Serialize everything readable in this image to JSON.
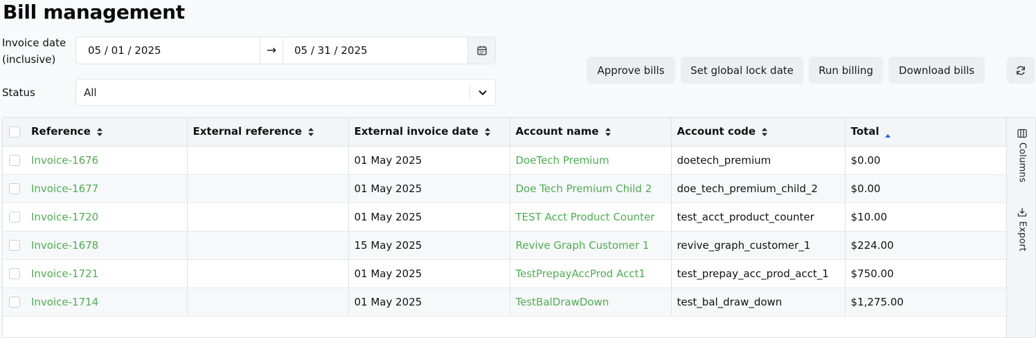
{
  "page": {
    "title": "Bill management"
  },
  "filters": {
    "invoice_date_label_line1": "Invoice date",
    "invoice_date_label_line2": "(inclusive)",
    "date_from": "05 / 01 / 2025",
    "date_arrow": "→",
    "date_to": "05 / 31 / 2025",
    "status_label": "Status",
    "status_value": "All"
  },
  "actions": {
    "approve": "Approve bills",
    "lock": "Set global lock date",
    "run": "Run billing",
    "download": "Download bills"
  },
  "table": {
    "columns": [
      "Reference",
      "External reference",
      "External invoice date",
      "Account name",
      "Account code",
      "Total"
    ],
    "sorted_column": "Total",
    "sort_direction": "ascending",
    "rows": [
      {
        "reference": "Invoice-1676",
        "external_reference": "",
        "external_invoice_date": "01 May 2025",
        "account_name": "DoeTech Premium",
        "account_code": "doetech_premium",
        "total": "$0.00"
      },
      {
        "reference": "Invoice-1677",
        "external_reference": "",
        "external_invoice_date": "01 May 2025",
        "account_name": "Doe Tech Premium Child 2",
        "account_code": "doe_tech_premium_child_2",
        "total": "$0.00"
      },
      {
        "reference": "Invoice-1720",
        "external_reference": "",
        "external_invoice_date": "01 May 2025",
        "account_name": "TEST Acct Product Counter",
        "account_code": "test_acct_product_counter",
        "total": "$10.00"
      },
      {
        "reference": "Invoice-1678",
        "external_reference": "",
        "external_invoice_date": "15 May 2025",
        "account_name": "Revive Graph Customer 1",
        "account_code": "revive_graph_customer_1",
        "total": "$224.00"
      },
      {
        "reference": "Invoice-1721",
        "external_reference": "",
        "external_invoice_date": "01 May 2025",
        "account_name": "TestPrepayAccProd Acct1",
        "account_code": "test_prepay_acc_prod_acct_1",
        "total": "$750.00"
      },
      {
        "reference": "Invoice-1714",
        "external_reference": "",
        "external_invoice_date": "01 May 2025",
        "account_name": "TestBalDrawDown",
        "account_code": "test_bal_draw_down",
        "total": "$1,275.00"
      }
    ]
  },
  "side_panel": {
    "columns": "Columns",
    "export": "Export"
  },
  "colors": {
    "link": "#4caf50",
    "sort_active": "#1e63d6"
  },
  "icons": [
    "calendar-icon",
    "chevron-down-icon",
    "refresh-icon",
    "sort-icon",
    "sort-asc-icon",
    "columns-icon",
    "export-icon"
  ]
}
